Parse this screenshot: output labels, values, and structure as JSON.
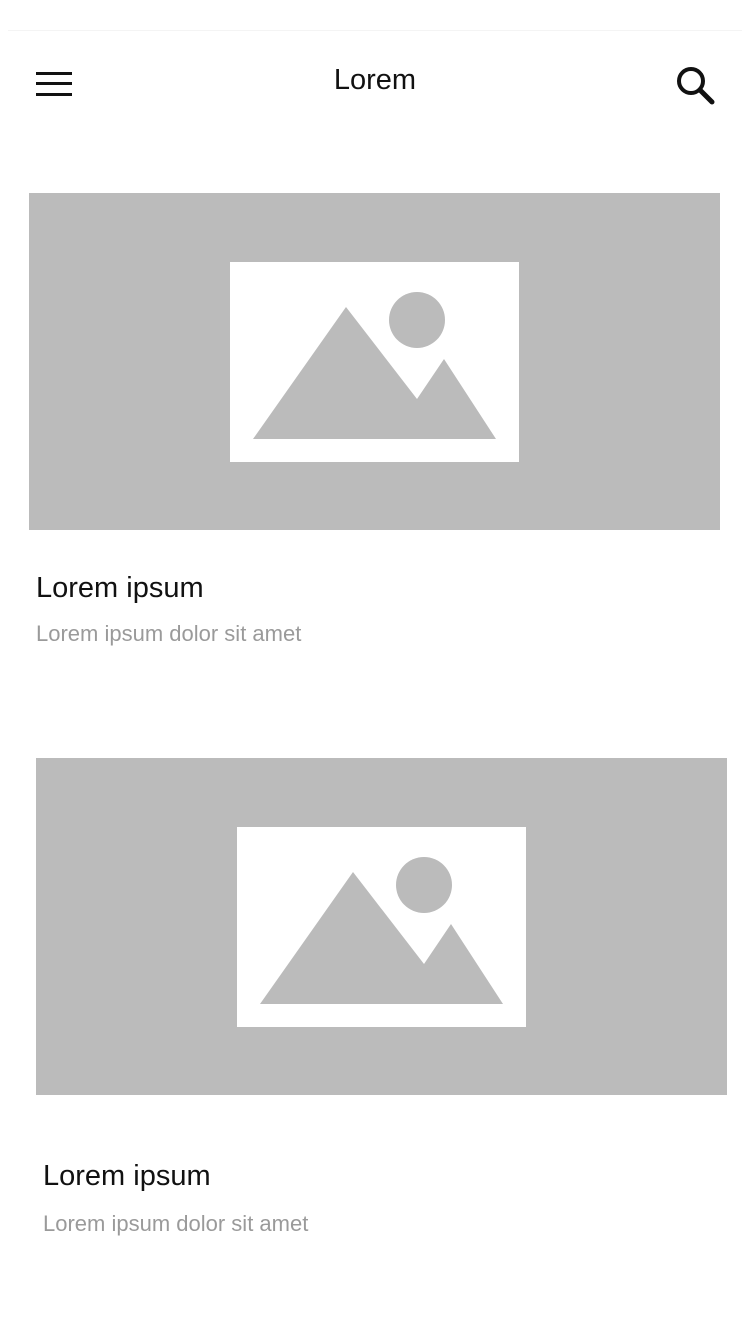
{
  "header": {
    "title": "Lorem",
    "menu_icon": "hamburger-menu-icon",
    "search_icon": "search-icon"
  },
  "cards": [
    {
      "image_icon": "image-placeholder-icon",
      "title": "Lorem ipsum",
      "subtitle": "Lorem ipsum dolor sit amet"
    },
    {
      "image_icon": "image-placeholder-icon",
      "title": "Lorem ipsum",
      "subtitle": "Lorem ipsum dolor sit amet"
    }
  ],
  "colors": {
    "placeholder_gray": "#bbbbbb",
    "title_text": "#111111",
    "subtitle_text": "#9a9a9a",
    "background": "#ffffff"
  }
}
